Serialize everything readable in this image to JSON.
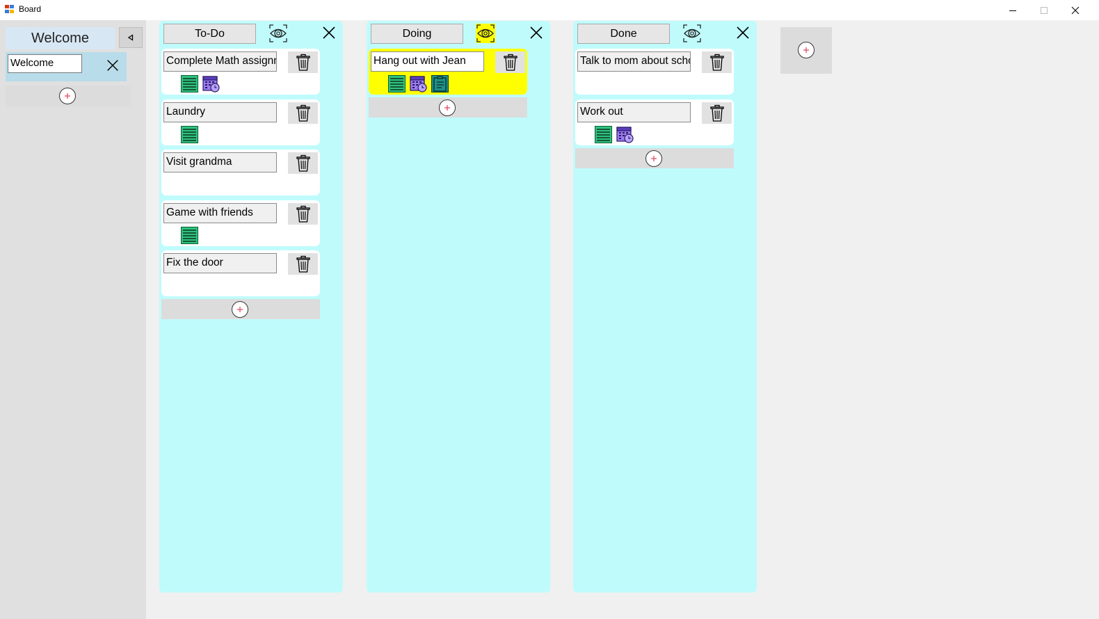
{
  "window": {
    "title": "Board"
  },
  "sidebar": {
    "tab_label": "Welcome",
    "input_value": "Welcome"
  },
  "columns": [
    {
      "title": "To-Do",
      "eye_active": false,
      "cards": [
        {
          "text": "Complete Math assignment",
          "icons": [
            "notes-icon",
            "calendar-clock-icon"
          ]
        },
        {
          "text": "Laundry",
          "icons": [
            "notes-icon"
          ]
        },
        {
          "text": "Visit grandma",
          "icons": []
        },
        {
          "text": "Game with friends",
          "icons": [
            "notes-icon"
          ]
        },
        {
          "text": "Fix the door",
          "icons": []
        }
      ]
    },
    {
      "title": "Doing",
      "eye_active": true,
      "cards": [
        {
          "text": "Hang out with Jean",
          "highlighted": true,
          "icons": [
            "notes-icon",
            "calendar-clock-icon",
            "checklist-icon"
          ]
        }
      ]
    },
    {
      "title": "Done",
      "eye_active": false,
      "cards": [
        {
          "text": "Talk to mom about school",
          "icons": []
        },
        {
          "text": "Work out",
          "icons": [
            "notes-icon",
            "calendar-clock-icon"
          ]
        }
      ]
    }
  ],
  "colors": {
    "column_bg": "#c0fbfc",
    "highlight": "#ffff00",
    "plus_accent": "#e0405a",
    "sidebar_panel": "#b8dcea"
  }
}
